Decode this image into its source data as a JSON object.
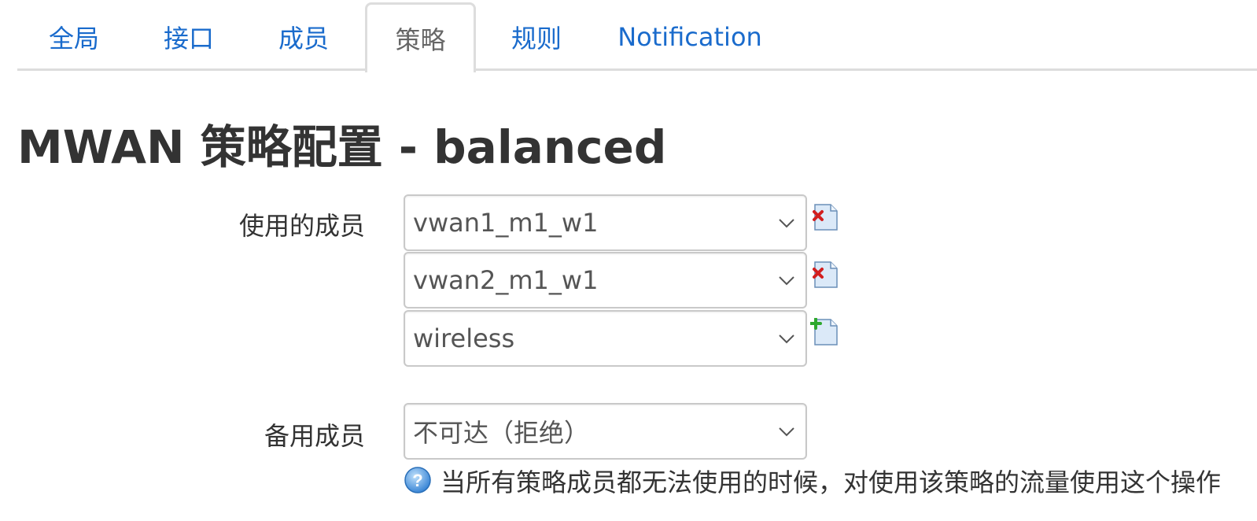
{
  "tabs": [
    {
      "label": "全局"
    },
    {
      "label": "接口"
    },
    {
      "label": "成员"
    },
    {
      "label": "策略"
    },
    {
      "label": "规则"
    },
    {
      "label": "Notification"
    }
  ],
  "page_title": "MWAN 策略配置 - balanced",
  "members_field": {
    "label": "使用的成员",
    "values": [
      "vwan1_m1_w1",
      "vwan2_m1_w1",
      "wireless"
    ]
  },
  "fallback_field": {
    "label": "备用成员",
    "value": "不可达（拒绝）",
    "hint": "当所有策略成员都无法使用的时候，对使用该策略的流量使用这个操作"
  },
  "icons": {
    "remove": "remove-icon",
    "add": "add-icon",
    "help": "help-icon",
    "dropdown": "chevron-down-icon"
  },
  "colors": {
    "link": "#1a6bcc",
    "remove_red": "#d21f1f",
    "add_green": "#2ea82e",
    "help_blue": "#3a86d6"
  }
}
